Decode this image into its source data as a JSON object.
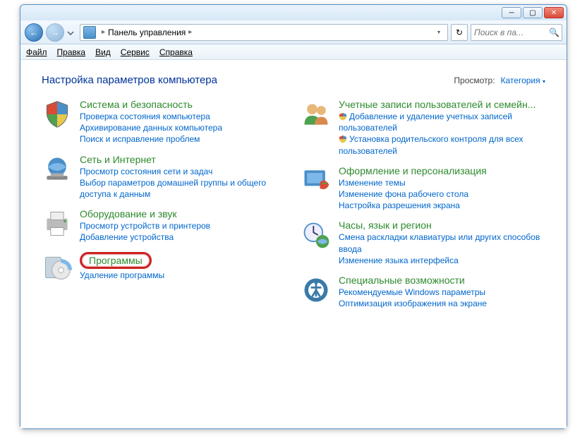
{
  "window": {
    "min_label": "─",
    "max_label": "▢",
    "close_label": "✕"
  },
  "nav": {
    "back_arrow": "←",
    "fwd_arrow": "→",
    "breadcrumb_root": "Панель управления",
    "breadcrumb_sep": "▸",
    "refresh_glyph": "↻",
    "search_placeholder": "Поиск в па...",
    "search_glyph": "🔍"
  },
  "menu": {
    "file": "Файл",
    "edit": "Правка",
    "view": "Вид",
    "service": "Сервис",
    "help": "Справка"
  },
  "heading": "Настройка параметров компьютера",
  "viewby": {
    "label": "Просмотр:",
    "value": "Категория",
    "arrow": "▾"
  },
  "left": [
    {
      "title": "Система и безопасность",
      "links": [
        "Проверка состояния компьютера",
        "Архивирование данных компьютера",
        "Поиск и исправление проблем"
      ]
    },
    {
      "title": "Сеть и Интернет",
      "links": [
        "Просмотр состояния сети и задач",
        "Выбор параметров домашней группы и общего доступа к данным"
      ]
    },
    {
      "title": "Оборудование и звук",
      "links": [
        "Просмотр устройств и принтеров",
        "Добавление устройства"
      ]
    },
    {
      "title": "Программы",
      "links": [
        "Удаление программы"
      ]
    }
  ],
  "right": [
    {
      "title": "Учетные записи пользователей и семейн...",
      "links": [
        {
          "shield": true,
          "text": "Добавление и удаление учетных записей пользователей"
        },
        {
          "shield": true,
          "text": "Установка родительского контроля для всех пользователей"
        }
      ]
    },
    {
      "title": "Оформление и персонализация",
      "links": [
        "Изменение темы",
        "Изменение фона рабочего стола",
        "Настройка разрешения экрана"
      ]
    },
    {
      "title": "Часы, язык и регион",
      "links": [
        "Смена раскладки клавиатуры или других способов ввода",
        "Изменение языка интерфейса"
      ]
    },
    {
      "title": "Специальные возможности",
      "links": [
        "Рекомендуемые Windows параметры",
        "Оптимизация изображения на экране"
      ]
    }
  ]
}
